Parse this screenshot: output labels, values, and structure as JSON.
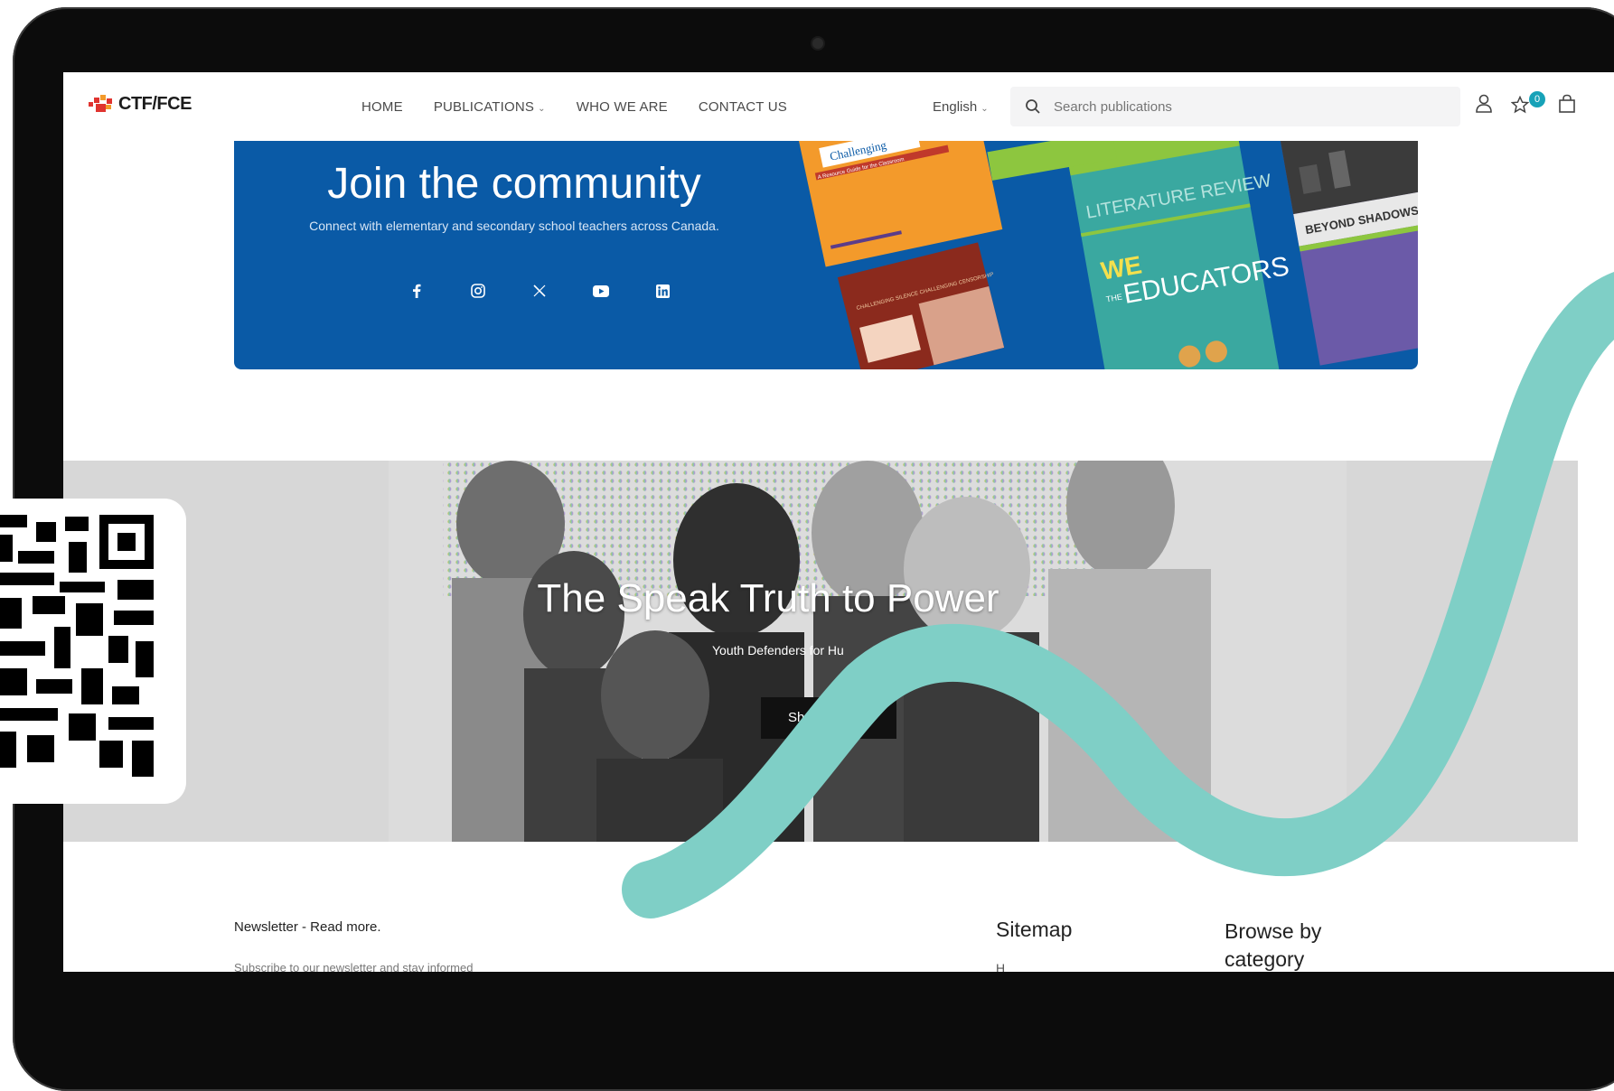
{
  "nav": {
    "logo_text": "CTF/FCE",
    "menu": [
      {
        "label": "HOME"
      },
      {
        "label": "PUBLICATIONS",
        "caret": "⌄"
      },
      {
        "label": "WHO WE ARE"
      },
      {
        "label": "CONTACT US"
      }
    ],
    "language": "English",
    "language_caret": "⌄",
    "search_placeholder": "Search publications",
    "cart_count": "0"
  },
  "banner": {
    "title": "Join the community",
    "subtitle": "Connect with elementary and secondary school teachers across Canada.",
    "social_icons": [
      "facebook-icon",
      "instagram-icon",
      "x-icon",
      "youtube-icon",
      "linkedin-icon"
    ],
    "books": [
      {
        "text": "Challenging",
        "subtext": "A Resource Guide for the Classroom"
      },
      {
        "text": "LITERATURE REVIEW",
        "heading_prefix": "THE",
        "heading_main": "WE",
        "heading_word": "EDUCATORS"
      },
      {
        "text": "BEYOND SHADOWS"
      },
      {
        "text": "CHALLENGING SILENCE CHALLENGING CENSORSHIP"
      }
    ]
  },
  "hero": {
    "title": "The Speak Truth to Power",
    "subtitle": "Youth Defenders for Hu",
    "button_label": "Sh"
  },
  "footer": {
    "newsletter_title": "Newsletter - Read more.",
    "newsletter_sub": "Subscribe to our newsletter and stay informed",
    "sitemap_title": "Sitemap",
    "sitemap_first": "H",
    "browse_title": "Browse by category"
  },
  "colors": {
    "banner_blue": "#0a5aa6",
    "teal_accent": "#7fcfc6",
    "badge": "#17a2b8",
    "logo_red": "#e0342f",
    "logo_orange": "#f39a2b"
  }
}
